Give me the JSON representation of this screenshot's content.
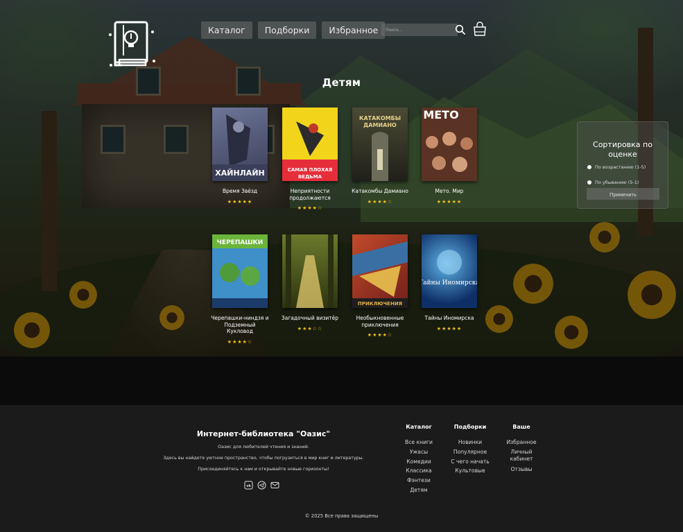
{
  "header": {
    "nav": [
      "Каталог",
      "Подборки",
      "Избранное"
    ],
    "search_placeholder": "Поиск..."
  },
  "page_title": "Детям",
  "books": [
    {
      "title": "Время Звёзд",
      "rating": "★★★★★",
      "cover_color": "#5a5f7a",
      "cover_text": "ХАЙНЛАЙН"
    },
    {
      "title": "Неприятности продолжаются",
      "rating": "★★★★☆",
      "cover_color": "#f1d21a",
      "cover_text": "САМАЯ ПЛОХАЯ ВЕДЬМА"
    },
    {
      "title": "Катакомбы Дамиано",
      "rating": "★★★★☆",
      "cover_color": "#3b3b2a",
      "cover_text": "КАТАКОМБЫ ДАМИАНО"
    },
    {
      "title": "Мето. Мир",
      "rating": "★★★★★",
      "cover_color": "#5a3324",
      "cover_text": "МЕТО"
    },
    {
      "title": "Черепашки-ниндзя и Подземный Кукловод",
      "rating": "★★★★☆",
      "cover_color": "#3f8fc9",
      "cover_text": "ЧЕРЕПАШКИ"
    },
    {
      "title": "Загадочный визитёр",
      "rating": "★★★☆☆",
      "cover_color": "#4a5a1e",
      "cover_text": ""
    },
    {
      "title": "Необыкновенные приключения",
      "rating": "★★★★☆",
      "cover_color": "#a8332a",
      "cover_text": "ПРИКЛЮЧЕНИЯ"
    },
    {
      "title": "Тайны Иномирска",
      "rating": "★★★★★",
      "cover_color": "#1b4f8f",
      "cover_text": "Тайны Иномирска"
    }
  ],
  "sort": {
    "title": "Сортировка по оценке",
    "options": [
      "По возрастанию (1-5)",
      "По убыванию (5-1)"
    ],
    "apply": "Применить"
  },
  "footer": {
    "brand": "Интернет-библиотека \"Оазис\"",
    "lines": [
      "Оазис для любителей чтения и знаний.",
      "Здесь вы найдете уютное пространство, чтобы погрузиться в мир книг и литературы.",
      "Присоединяйтесь к нам и открывайте новые горизонты!"
    ],
    "columns": [
      {
        "title": "Каталог",
        "links": [
          "Все книги",
          "Ужасы",
          "Комедии",
          "Классика",
          "Фэнтези",
          "Детям"
        ]
      },
      {
        "title": "Подборки",
        "links": [
          "Новинки",
          "Популярное",
          "С чего начать",
          "Культовые"
        ]
      },
      {
        "title": "Ваше",
        "links": [
          "Избранное",
          "Личный кабинет",
          "Отзывы"
        ]
      }
    ],
    "copyright": "© 2025 Все права защищены"
  }
}
